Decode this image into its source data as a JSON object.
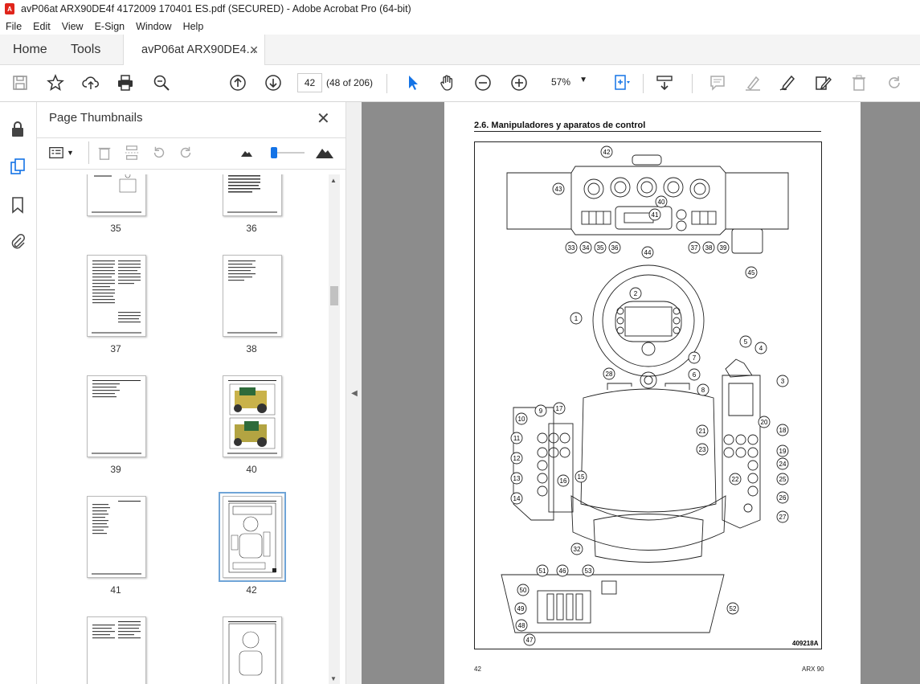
{
  "window": {
    "title": "avP06at ARX90DE4f 4172009 170401 ES.pdf (SECURED) - Adobe Acrobat Pro (64-bit)"
  },
  "menu": [
    "File",
    "Edit",
    "View",
    "E-Sign",
    "Window",
    "Help"
  ],
  "tabs": {
    "home": "Home",
    "tools": "Tools",
    "document": "avP06at ARX90DE4..."
  },
  "toolbar": {
    "page_number": "42",
    "page_count": "(48 of 206)",
    "zoom": "57%"
  },
  "panel": {
    "title": "Page Thumbnails",
    "thumbnails": [
      {
        "label": "35"
      },
      {
        "label": "36"
      },
      {
        "label": "37"
      },
      {
        "label": "38"
      },
      {
        "label": "39"
      },
      {
        "label": "40"
      },
      {
        "label": "41"
      },
      {
        "label": "42",
        "selected": true
      },
      {
        "label": ""
      },
      {
        "label": ""
      }
    ]
  },
  "document_page": {
    "heading": "2.6.    Manipuladores y aparatos de control",
    "figure_code": "409218A",
    "footer_left": "42",
    "footer_right": "ARX 90",
    "callouts": [
      "1",
      "2",
      "3",
      "4",
      "5",
      "6",
      "7",
      "8",
      "9",
      "10",
      "11",
      "12",
      "13",
      "14",
      "15",
      "16",
      "17",
      "18",
      "19",
      "20",
      "21",
      "22",
      "23",
      "24",
      "25",
      "26",
      "27",
      "28",
      "32",
      "33",
      "34",
      "35",
      "36",
      "37",
      "38",
      "39",
      "40",
      "41",
      "42",
      "43",
      "44",
      "45",
      "46",
      "47",
      "48",
      "49",
      "50",
      "51",
      "52",
      "53"
    ]
  },
  "colors": {
    "accent": "#1473e6",
    "pdf_red": "#e0251b",
    "viewer_bg": "#8c8c8c"
  }
}
